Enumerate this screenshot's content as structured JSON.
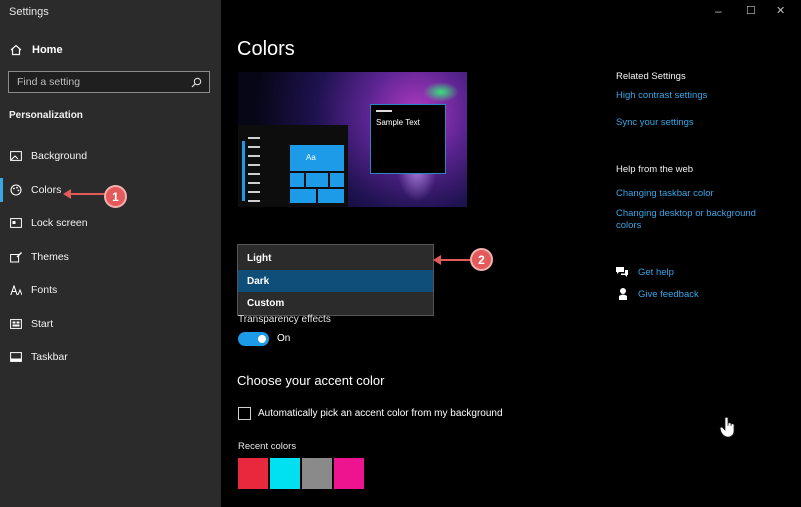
{
  "app": {
    "title": "Settings"
  },
  "window_controls": {
    "minimize": "–",
    "maximize": "☐",
    "close": "✕"
  },
  "sidebar": {
    "home_label": "Home",
    "search_placeholder": "Find a setting",
    "section": "Personalization",
    "items": [
      {
        "label": "Background",
        "icon": "picture-icon"
      },
      {
        "label": "Colors",
        "icon": "palette-icon",
        "selected": true
      },
      {
        "label": "Lock screen",
        "icon": "lock-screen-icon"
      },
      {
        "label": "Themes",
        "icon": "brush-icon"
      },
      {
        "label": "Fonts",
        "icon": "fonts-icon"
      },
      {
        "label": "Start",
        "icon": "start-icon"
      },
      {
        "label": "Taskbar",
        "icon": "taskbar-icon"
      }
    ]
  },
  "callouts": {
    "one": "1",
    "two": "2"
  },
  "main": {
    "title": "Colors",
    "preview": {
      "sample_text": "Sample Text",
      "tile_text": "Aa"
    },
    "mode_dropdown": {
      "options": [
        "Light",
        "Dark",
        "Custom"
      ],
      "selected": "Dark"
    },
    "transparency": {
      "label": "Transparency effects",
      "state": "On",
      "on": true
    },
    "accent": {
      "title": "Choose your accent color",
      "auto_pick_label": "Automatically pick an accent color from my background",
      "auto_pick_checked": false,
      "recent_label": "Recent colors",
      "recent_colors": [
        "#e8283c",
        "#00e0f0",
        "#8a8a8a",
        "#ee1490"
      ]
    }
  },
  "related": {
    "heading": "Related Settings",
    "links": [
      "High contrast settings",
      "Sync your settings"
    ],
    "help_heading": "Help from the web",
    "help_links": [
      "Changing taskbar color",
      "Changing desktop or background colors"
    ],
    "get_help": "Get help",
    "give_feedback": "Give feedback"
  },
  "colors": {
    "accent": "#1e9be8",
    "link": "#3aa6e6",
    "sidebar_bg": "#2b2b2b",
    "callout": "#e35a5a"
  }
}
